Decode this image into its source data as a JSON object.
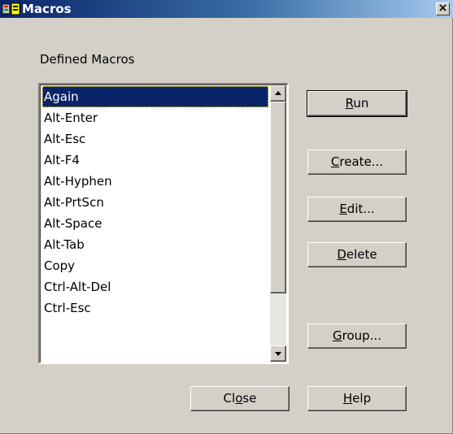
{
  "window": {
    "title": "Macros",
    "close_glyph": "×"
  },
  "label": "Defined Macros",
  "macros": {
    "items": [
      "Again",
      "Alt-Enter",
      "Alt-Esc",
      "Alt-F4",
      "Alt-Hyphen",
      "Alt-PrtScn",
      "Alt-Space",
      "Alt-Tab",
      "Copy",
      "Ctrl-Alt-Del",
      "Ctrl-Esc"
    ],
    "selected": "Again"
  },
  "buttons": {
    "run": {
      "pre": "",
      "key": "R",
      "post": "un"
    },
    "create": {
      "pre": "",
      "key": "C",
      "post": "reate..."
    },
    "edit": {
      "pre": "",
      "key": "E",
      "post": "dit..."
    },
    "delete": {
      "pre": "",
      "key": "D",
      "post": "elete"
    },
    "group": {
      "pre": "",
      "key": "G",
      "post": "roup..."
    },
    "close": {
      "pre": "Cl",
      "key": "o",
      "post": "se"
    },
    "help": {
      "pre": "",
      "key": "H",
      "post": "elp"
    }
  },
  "colors": {
    "selection": "#0a246a",
    "face": "#d4d0c8",
    "title_start": "#0a246a",
    "title_end": "#a6caf0"
  }
}
